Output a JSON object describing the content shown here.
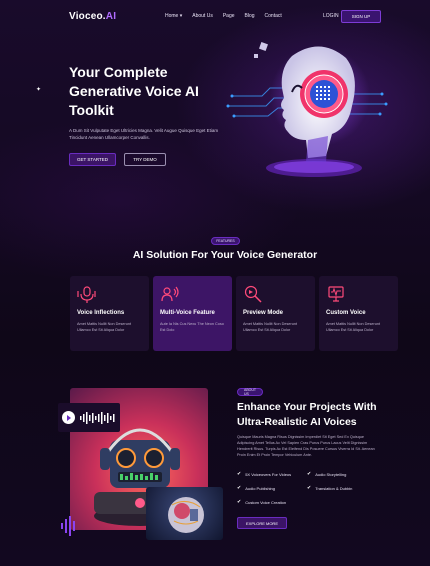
{
  "nav": {
    "logo_main": "Vioceo.",
    "logo_accent": "AI",
    "items": [
      "Home",
      "About Us",
      "Page",
      "Blog",
      "Contact"
    ],
    "home_caret": "▾",
    "login": "LOGIN",
    "signup": "SIGN UP"
  },
  "hero": {
    "title": "Your Complete Generative Voice AI Toolkit",
    "description": "A Dum Sit Vulputate Eget Ultricies Magna. Velit Augue Quisque Eget Etiam Tincidunt Aenean Ullamcorper Convallis.",
    "get_started": "GET STARTED",
    "try_demo": "TRY DEMO"
  },
  "features": {
    "badge": "FEATURES",
    "title": "AI Solution For Your Voice Generator",
    "cards": [
      {
        "title": "Voice Inflections",
        "desc": "Amet Mattis Nullit Non Deserunt Ullamco Est Sit Aliqua Dolor",
        "icon": "voice-inflection-icon"
      },
      {
        "title": "Multi-Voice Feature",
        "desc": "Aute Ia Nis Cus Nexu The Neon Coso Est Dolo",
        "icon": "multi-voice-icon"
      },
      {
        "title": "Preview Mode",
        "desc": "Amet Mattis Nullit Non Deserunt Ullamco Est Sit Aliqua Dolor",
        "icon": "preview-icon"
      },
      {
        "title": "Custom Voice",
        "desc": "Amet Mattis Nullit Non Deserunt Ullamco Est Sit Aliqua Dolor",
        "icon": "custom-voice-icon"
      }
    ]
  },
  "about": {
    "badge": "ABOUT US",
    "title": "Enhance Your Projects With Ultra-Realistic AI Voices",
    "description": "Quisque Mauris Magna Risus Dignissim Imperdiet Sit Eget Sed Ex Quisque Adipiscing Amet Tellus Ac Vel Sapien Cras Purus Purus Lacus Velit Dignissim Hendrerit Risus. Turpis Ac Est Eleifend Dis Posuere Cursus Viverra Id Sit. Aenean Proin Enim Et Proin Tempor Vehiculum Ante.",
    "features": [
      "5X Voiceovers For Videos",
      "Audio Storytelling",
      "Audio Publishing",
      "Translation & Dubbin",
      "Custom Voice Creation"
    ],
    "explore": "EXPLORE MORE"
  },
  "colors": {
    "accent": "#7d3cd6",
    "button_bg": "#3b1466",
    "nav_active": "#e0457b",
    "background": "#0f0718"
  }
}
